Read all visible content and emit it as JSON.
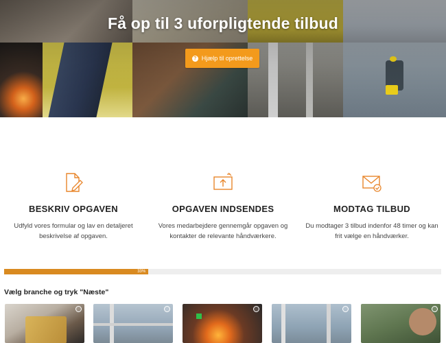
{
  "hero": {
    "title": "Få op til 3 uforpligtende tilbud",
    "help_button": "Hjælp til oprettelse",
    "help_icon": "question-circle-icon",
    "accent_color": "#f39a1c"
  },
  "steps": [
    {
      "icon": "document-edit-icon",
      "title": "BESKRIV OPGAVEN",
      "desc": "Udfyld vores formular og lav en detaljeret beskrivelse af opgaven."
    },
    {
      "icon": "upload-send-icon",
      "title": "OPGAVEN INDSENDES",
      "desc": "Vores medarbejdere gennemgår opgaven og kontakter de relevante håndværkere."
    },
    {
      "icon": "mail-check-icon",
      "title": "MODTAG TILBUD",
      "desc": "Du modtager 3 tilbud indenfor 48 timer og kan frit vælge en håndværker."
    }
  ],
  "progress": {
    "value": 0.33,
    "label": "33%"
  },
  "category_prompt": "Vælg branche og tryk \"Næste\"",
  "categories": [
    {
      "name": "carpenter",
      "selected": false
    },
    {
      "name": "scaffolding",
      "selected": false
    },
    {
      "name": "metalwork",
      "selected": false
    },
    {
      "name": "construction",
      "selected": false
    },
    {
      "name": "garden",
      "selected": false
    }
  ]
}
